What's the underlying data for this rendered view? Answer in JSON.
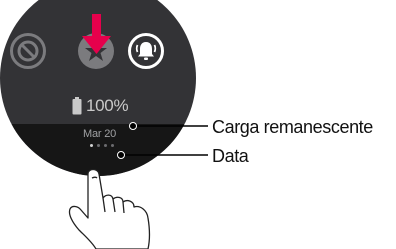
{
  "status": {
    "battery_percent": "100%",
    "date": "Mar 20"
  },
  "quick_settings": {
    "buttons": [
      {
        "icon": "do-not-disturb-icon",
        "state": "off"
      },
      {
        "icon": "star-icon",
        "state": "selected"
      },
      {
        "icon": "bell-alerts-icon",
        "state": "on"
      }
    ]
  },
  "pagination": {
    "count": 4,
    "active_index": 0
  },
  "callouts": {
    "battery_label": "Carga remanescente",
    "date_label": "Data"
  },
  "colors": {
    "watch_face": "#333336",
    "watch_bottom": "#161616",
    "arrow": "#e6004c",
    "icon_inactive": "#7b7b7e",
    "icon_active": "#ffffff",
    "callout_line": "#000000"
  }
}
